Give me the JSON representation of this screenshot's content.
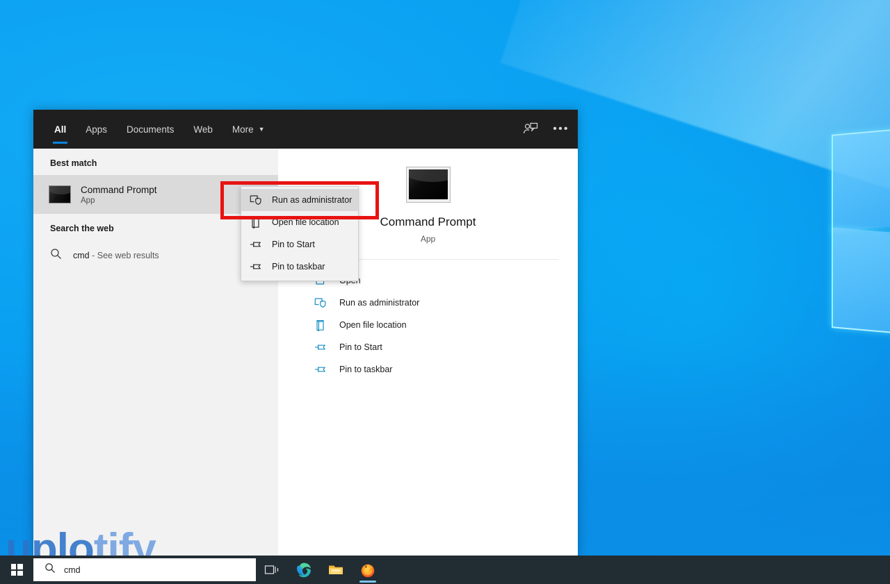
{
  "desktop": {
    "wallpaper_name": "windows-10-light-wallpaper"
  },
  "search_panel": {
    "tabs": [
      {
        "label": "All",
        "active": true
      },
      {
        "label": "Apps",
        "active": false
      },
      {
        "label": "Documents",
        "active": false
      },
      {
        "label": "Web",
        "active": false
      },
      {
        "label": "More",
        "active": false,
        "has_caret": true
      }
    ],
    "header_icons": [
      {
        "name": "feedback-icon",
        "glyph": "person-with-comment"
      },
      {
        "name": "more-options-icon",
        "glyph": "•••"
      }
    ],
    "left": {
      "best_match_heading": "Best match",
      "best_match": {
        "title": "Command Prompt",
        "subtitle": "App",
        "icon": "command-prompt-icon",
        "selected": true
      },
      "search_web_heading": "Search the web",
      "web_result": {
        "query": "cmd",
        "suffix": "- See web results",
        "icon": "search-icon"
      }
    },
    "right": {
      "app_title": "Command Prompt",
      "app_subtitle": "App",
      "app_icon": "command-prompt-thumbnail",
      "actions": [
        {
          "label": "Open",
          "icon": "open-icon"
        },
        {
          "label": "Run as administrator",
          "icon": "shield-run-icon"
        },
        {
          "label": "Open file location",
          "icon": "folder-location-icon"
        },
        {
          "label": "Pin to Start",
          "icon": "pin-icon"
        },
        {
          "label": "Pin to taskbar",
          "icon": "pin-icon"
        }
      ]
    }
  },
  "context_menu": {
    "items": [
      {
        "label": "Run as administrator",
        "icon": "shield-run-icon",
        "highlighted": true
      },
      {
        "label": "Open file location",
        "icon": "folder-location-icon",
        "highlighted": false
      },
      {
        "label": "Pin to Start",
        "icon": "pin-icon",
        "highlighted": false
      },
      {
        "label": "Pin to taskbar",
        "icon": "pin-icon",
        "highlighted": false
      }
    ]
  },
  "annotation": {
    "color": "#e81313",
    "target": "Run as administrator"
  },
  "watermark": {
    "part1": "uplo",
    "part2": "tify",
    "color1": "#2e72c9",
    "color2": "#6f9fe0"
  },
  "taskbar": {
    "start_label": "Start",
    "search": {
      "value": "cmd",
      "icon": "search-icon"
    },
    "buttons": [
      {
        "name": "task-view-button",
        "label": "Task View",
        "active": false
      },
      {
        "name": "microsoft-edge-button",
        "label": "Microsoft Edge",
        "active": false
      },
      {
        "name": "file-explorer-button",
        "label": "File Explorer",
        "active": false
      },
      {
        "name": "firefox-button",
        "label": "Firefox",
        "active": true
      }
    ]
  },
  "colors": {
    "accent_blue": "#0a84e0",
    "panel_dark": "#1f1f1f",
    "panel_left": "#f2f2f2",
    "panel_right": "#ffffff",
    "selection": "#dadada",
    "taskbar": "#222c33",
    "annotation_red": "#e81313"
  }
}
